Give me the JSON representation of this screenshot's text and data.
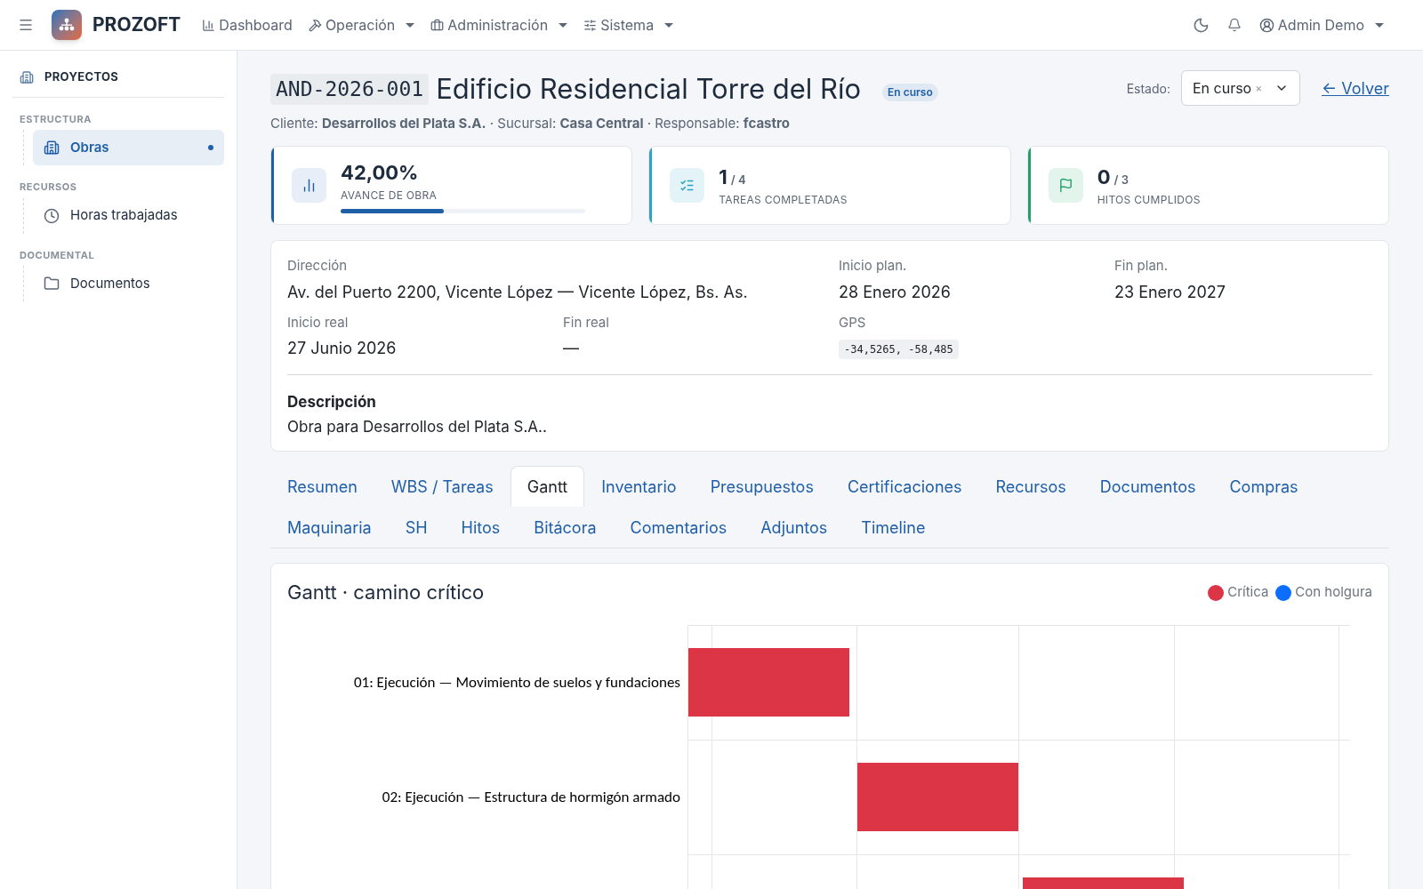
{
  "topbar": {
    "brand": "PROZOFT",
    "nav": [
      {
        "label": "Dashboard",
        "kind": "link"
      },
      {
        "label": "Operación",
        "kind": "dropdown"
      },
      {
        "label": "Administración",
        "kind": "dropdown"
      },
      {
        "label": "Sistema",
        "kind": "dropdown"
      }
    ],
    "user": "Admin Demo"
  },
  "sidebar": {
    "title": "PROYECTOS",
    "sections": [
      {
        "heading": "ESTRUCTURA",
        "items": [
          {
            "label": "Obras",
            "selected": true
          }
        ]
      },
      {
        "heading": "RECURSOS",
        "items": [
          {
            "label": "Horas trabajadas",
            "selected": false
          }
        ]
      },
      {
        "heading": "DOCUMENTAL",
        "items": [
          {
            "label": "Documentos",
            "selected": false
          }
        ]
      }
    ]
  },
  "project": {
    "code": "AND-2026-001",
    "name": "Edificio Residencial Torre del Río",
    "badge": "En curso",
    "meta": "Cliente: **Desarrollos del Plata S.A.** · Sucursal: **Casa Central** · Responsable: **fcastro**",
    "estado_label": "Estado:",
    "estado_value": "En curso",
    "clear": "×",
    "back": "← Volver"
  },
  "stats": [
    {
      "value": "42,00%",
      "label": "AVANCE DE OBRA",
      "level": 0.42,
      "color": "#1f5fa8"
    },
    {
      "value": "1",
      "total": "/ 4",
      "label": "TAREAS COMPLETADAS",
      "color": "#2ba3c2"
    },
    {
      "value": "0",
      "total": "/ 3",
      "label": "HITOS CUMPLIDOS",
      "color": "#22a06b"
    }
  ],
  "details": [
    {
      "label": "Dirección",
      "value": "Av. del Puerto 2200, Vicente López — Vicente López, Bs. As."
    },
    {
      "label": "Inicio plan.",
      "value": "28 Enero 2026"
    },
    {
      "label": "Fin plan.",
      "value": "23 Enero 2027"
    },
    {
      "label": "Inicio real",
      "value": "27 Junio 2026"
    },
    {
      "label": "Fin real",
      "value": "—"
    },
    {
      "label": "GPS",
      "value": "-34,5265, -58,485",
      "kind": "code"
    }
  ],
  "description": {
    "title": "Descripción",
    "text": "Obra para Desarrollos del Plata S.A.."
  },
  "tabs": [
    {
      "label": "Resumen",
      "selected": false
    },
    {
      "label": "WBS / Tareas",
      "selected": false
    },
    {
      "label": "Gantt",
      "selected": true
    },
    {
      "label": "Inventario",
      "selected": false
    },
    {
      "label": "Presupuestos",
      "selected": false
    },
    {
      "label": "Certificaciones",
      "selected": false
    },
    {
      "label": "Recursos",
      "selected": false
    },
    {
      "label": "Documentos",
      "selected": false
    },
    {
      "label": "Compras",
      "selected": false
    },
    {
      "label": "Maquinaria",
      "selected": false
    },
    {
      "label": "SH",
      "selected": false
    },
    {
      "label": "Hitos",
      "selected": false
    },
    {
      "label": "Bitácora",
      "selected": false
    },
    {
      "label": "Comentarios",
      "selected": false
    },
    {
      "label": "Adjuntos",
      "selected": false
    },
    {
      "label": "Timeline",
      "selected": false
    }
  ],
  "gantt": {
    "title": "Gantt · camino crítico",
    "legend": [
      {
        "label": "Crítica",
        "color": "#dc3545"
      },
      {
        "label": "Con holgura",
        "color": "#0d6efd"
      }
    ],
    "tasks": [
      {
        "label": "01: Ejecución — Movimiento de suelos y fundaciones",
        "critical": true
      },
      {
        "label": "02: Ejecución — Estructura de hormigón armado",
        "critical": true
      },
      {
        "critical": true
      }
    ]
  }
}
